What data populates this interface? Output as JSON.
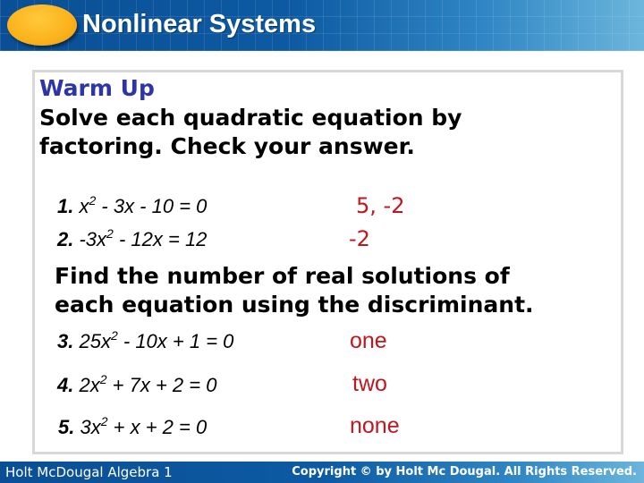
{
  "header": {
    "title": "Nonlinear Systems"
  },
  "warmup": {
    "heading": "Warm Up",
    "instruction_1_line1": "Solve each quadratic equation by",
    "instruction_1_line2": "factoring. Check your answer.",
    "instruction_2_line1": "Find the number of real solutions of",
    "instruction_2_line2": "each equation using the discriminant.",
    "problems": [
      {
        "num": "1.",
        "pre": "x",
        "sup": "2",
        "post": " - 3x - 10 = 0",
        "answer": "5, -2"
      },
      {
        "num": "2.",
        "pre": "-3x",
        "sup": "2",
        "post": " - 12x = 12",
        "answer": "-2"
      },
      {
        "num": "3.",
        "pre": "25x",
        "sup": "2",
        "post": " - 10x + 1 = 0",
        "answer": "one"
      },
      {
        "num": "4.",
        "pre": "2x",
        "sup": "2",
        "post": " + 7x + 2 = 0",
        "answer": "two"
      },
      {
        "num": "5.",
        "pre": "3x",
        "sup": "2",
        "post": " + x + 2 = 0",
        "answer": "none"
      }
    ]
  },
  "footer": {
    "left": "Holt McDougal Algebra 1",
    "right": "Copyright © by Holt Mc Dougal. All Rights Reserved."
  },
  "colors": {
    "header_blue": "#0d5aa3",
    "accent_orange": "#fbb21c",
    "heading_blue": "#2e35a8",
    "answer_red": "#c0161e"
  }
}
